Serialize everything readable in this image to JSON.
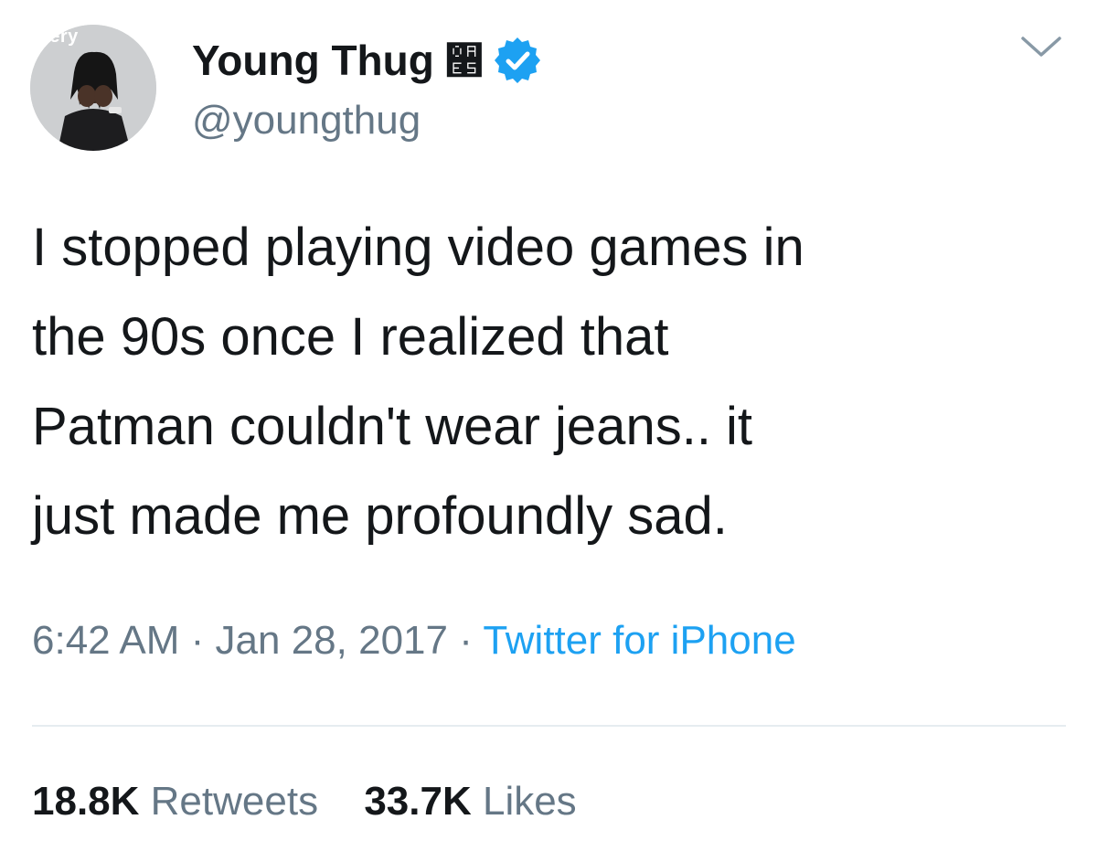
{
  "user": {
    "display_name": "Young Thug",
    "name_emoji": "૥",
    "handle": "@youngthug",
    "avatar_tag": "ifery",
    "verified": true
  },
  "tweet": {
    "text": "I stopped playing video games in\nthe 90s once I realized that\nPatman couldn't wear jeans.. it\njust made me profoundly sad."
  },
  "meta": {
    "time": "6:42 AM",
    "separator": " · ",
    "date": "Jan 28, 2017",
    "source": "Twitter for iPhone"
  },
  "stats": {
    "retweets_count": "18.8K",
    "retweets_label": "Retweets",
    "likes_count": "33.7K",
    "likes_label": "Likes"
  },
  "colors": {
    "primary_text": "#14171a",
    "secondary_text": "#657786",
    "accent": "#1da1f2",
    "divider": "#e6ecf0"
  },
  "icons": {
    "verified": "verified-badge-icon",
    "menu": "chevron-down-icon"
  }
}
